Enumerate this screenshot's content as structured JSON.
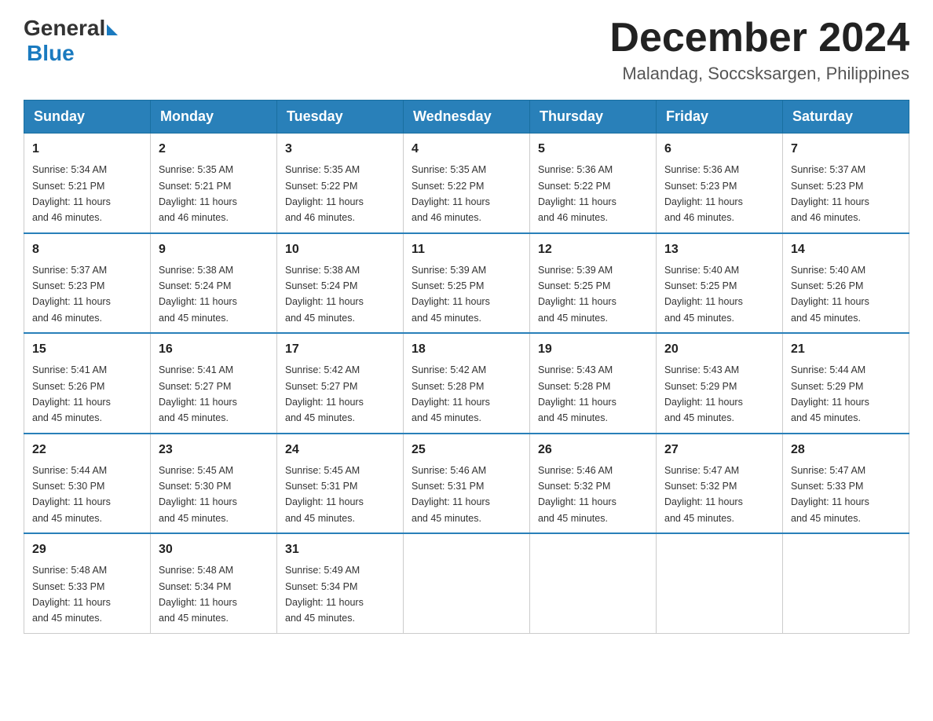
{
  "logo": {
    "text_general": "General",
    "triangle": "",
    "text_blue": "Blue"
  },
  "title": "December 2024",
  "subtitle": "Malandag, Soccsksargen, Philippines",
  "days_of_week": [
    "Sunday",
    "Monday",
    "Tuesday",
    "Wednesday",
    "Thursday",
    "Friday",
    "Saturday"
  ],
  "weeks": [
    [
      {
        "day": "1",
        "sunrise": "5:34 AM",
        "sunset": "5:21 PM",
        "daylight": "11 hours and 46 minutes."
      },
      {
        "day": "2",
        "sunrise": "5:35 AM",
        "sunset": "5:21 PM",
        "daylight": "11 hours and 46 minutes."
      },
      {
        "day": "3",
        "sunrise": "5:35 AM",
        "sunset": "5:22 PM",
        "daylight": "11 hours and 46 minutes."
      },
      {
        "day": "4",
        "sunrise": "5:35 AM",
        "sunset": "5:22 PM",
        "daylight": "11 hours and 46 minutes."
      },
      {
        "day": "5",
        "sunrise": "5:36 AM",
        "sunset": "5:22 PM",
        "daylight": "11 hours and 46 minutes."
      },
      {
        "day": "6",
        "sunrise": "5:36 AM",
        "sunset": "5:23 PM",
        "daylight": "11 hours and 46 minutes."
      },
      {
        "day": "7",
        "sunrise": "5:37 AM",
        "sunset": "5:23 PM",
        "daylight": "11 hours and 46 minutes."
      }
    ],
    [
      {
        "day": "8",
        "sunrise": "5:37 AM",
        "sunset": "5:23 PM",
        "daylight": "11 hours and 46 minutes."
      },
      {
        "day": "9",
        "sunrise": "5:38 AM",
        "sunset": "5:24 PM",
        "daylight": "11 hours and 45 minutes."
      },
      {
        "day": "10",
        "sunrise": "5:38 AM",
        "sunset": "5:24 PM",
        "daylight": "11 hours and 45 minutes."
      },
      {
        "day": "11",
        "sunrise": "5:39 AM",
        "sunset": "5:25 PM",
        "daylight": "11 hours and 45 minutes."
      },
      {
        "day": "12",
        "sunrise": "5:39 AM",
        "sunset": "5:25 PM",
        "daylight": "11 hours and 45 minutes."
      },
      {
        "day": "13",
        "sunrise": "5:40 AM",
        "sunset": "5:25 PM",
        "daylight": "11 hours and 45 minutes."
      },
      {
        "day": "14",
        "sunrise": "5:40 AM",
        "sunset": "5:26 PM",
        "daylight": "11 hours and 45 minutes."
      }
    ],
    [
      {
        "day": "15",
        "sunrise": "5:41 AM",
        "sunset": "5:26 PM",
        "daylight": "11 hours and 45 minutes."
      },
      {
        "day": "16",
        "sunrise": "5:41 AM",
        "sunset": "5:27 PM",
        "daylight": "11 hours and 45 minutes."
      },
      {
        "day": "17",
        "sunrise": "5:42 AM",
        "sunset": "5:27 PM",
        "daylight": "11 hours and 45 minutes."
      },
      {
        "day": "18",
        "sunrise": "5:42 AM",
        "sunset": "5:28 PM",
        "daylight": "11 hours and 45 minutes."
      },
      {
        "day": "19",
        "sunrise": "5:43 AM",
        "sunset": "5:28 PM",
        "daylight": "11 hours and 45 minutes."
      },
      {
        "day": "20",
        "sunrise": "5:43 AM",
        "sunset": "5:29 PM",
        "daylight": "11 hours and 45 minutes."
      },
      {
        "day": "21",
        "sunrise": "5:44 AM",
        "sunset": "5:29 PM",
        "daylight": "11 hours and 45 minutes."
      }
    ],
    [
      {
        "day": "22",
        "sunrise": "5:44 AM",
        "sunset": "5:30 PM",
        "daylight": "11 hours and 45 minutes."
      },
      {
        "day": "23",
        "sunrise": "5:45 AM",
        "sunset": "5:30 PM",
        "daylight": "11 hours and 45 minutes."
      },
      {
        "day": "24",
        "sunrise": "5:45 AM",
        "sunset": "5:31 PM",
        "daylight": "11 hours and 45 minutes."
      },
      {
        "day": "25",
        "sunrise": "5:46 AM",
        "sunset": "5:31 PM",
        "daylight": "11 hours and 45 minutes."
      },
      {
        "day": "26",
        "sunrise": "5:46 AM",
        "sunset": "5:32 PM",
        "daylight": "11 hours and 45 minutes."
      },
      {
        "day": "27",
        "sunrise": "5:47 AM",
        "sunset": "5:32 PM",
        "daylight": "11 hours and 45 minutes."
      },
      {
        "day": "28",
        "sunrise": "5:47 AM",
        "sunset": "5:33 PM",
        "daylight": "11 hours and 45 minutes."
      }
    ],
    [
      {
        "day": "29",
        "sunrise": "5:48 AM",
        "sunset": "5:33 PM",
        "daylight": "11 hours and 45 minutes."
      },
      {
        "day": "30",
        "sunrise": "5:48 AM",
        "sunset": "5:34 PM",
        "daylight": "11 hours and 45 minutes."
      },
      {
        "day": "31",
        "sunrise": "5:49 AM",
        "sunset": "5:34 PM",
        "daylight": "11 hours and 45 minutes."
      },
      null,
      null,
      null,
      null
    ]
  ],
  "labels": {
    "sunrise": "Sunrise:",
    "sunset": "Sunset:",
    "daylight": "Daylight:"
  }
}
